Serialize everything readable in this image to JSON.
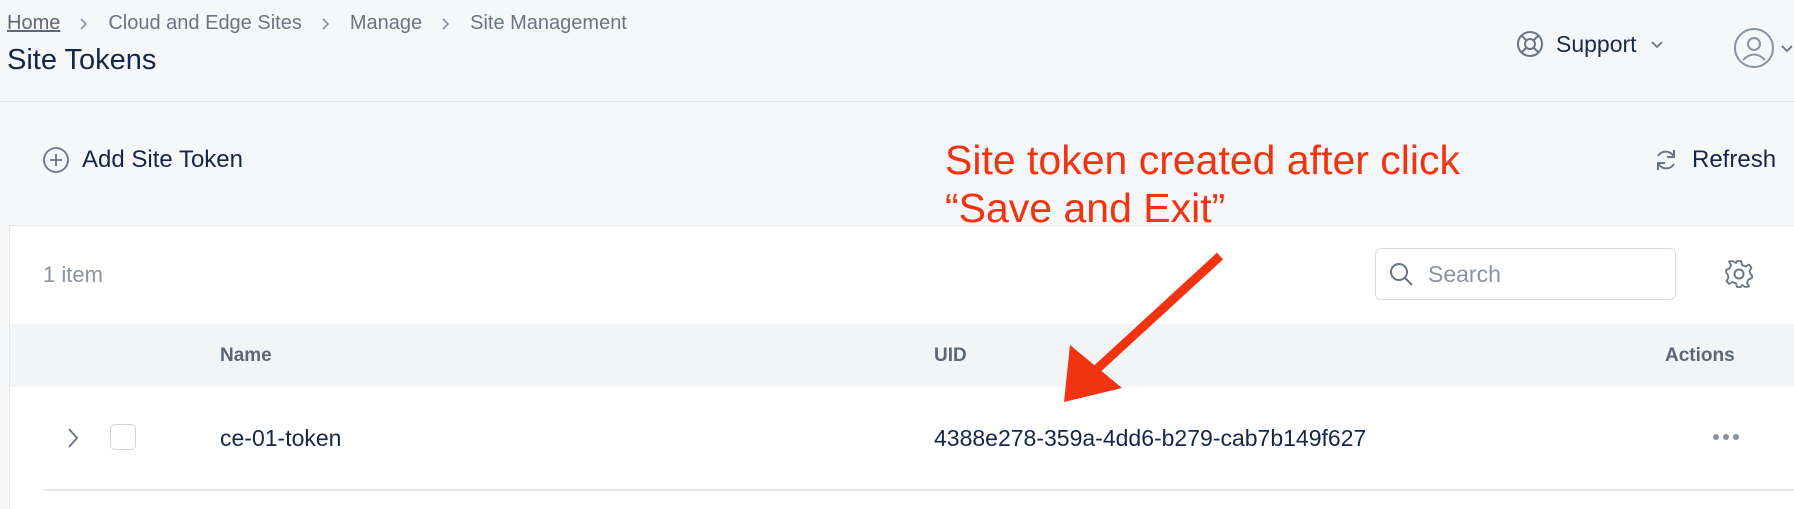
{
  "breadcrumb": {
    "items": [
      "Home",
      "Cloud and Edge Sites",
      "Manage",
      "Site Management"
    ]
  },
  "page_title": "Site Tokens",
  "header": {
    "support_label": "Support"
  },
  "toolbar": {
    "add_label": "Add Site Token",
    "refresh_label": "Refresh"
  },
  "list": {
    "item_count": "1 item",
    "search_placeholder": "Search",
    "columns": {
      "name": "Name",
      "uid": "UID",
      "actions": "Actions"
    },
    "rows": [
      {
        "name": "ce-01-token",
        "uid": "4388e278-359a-4dd6-b279-cab7b149f627"
      }
    ]
  },
  "annotation": {
    "line1": "Site token created after click",
    "line2": "“Save and Exit”"
  },
  "colors": {
    "annotation": "#f23312",
    "text_primary": "#15264a",
    "text_muted": "#8a93a3"
  },
  "icons": [
    "chevron-right-icon",
    "support-lifebuoy-icon",
    "chevron-down-icon",
    "user-avatar-icon",
    "plus-circle-icon",
    "refresh-icon",
    "search-icon",
    "settings-gear-icon",
    "more-horizontal-icon"
  ]
}
